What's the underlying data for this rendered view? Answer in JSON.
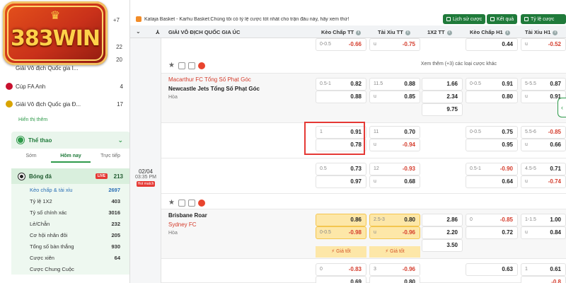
{
  "brand": {
    "logo_text": "383WIN"
  },
  "sidebar": {
    "top_counts": [
      "+7",
      "22",
      "20"
    ],
    "leagues": [
      {
        "label": "Giải Vô địch Quốc gia I...",
        "count": "20"
      },
      {
        "label": "Cúp FA Anh",
        "count": "4"
      },
      {
        "label": "Giải Vô địch Quốc gia Đ...",
        "count": "17"
      }
    ],
    "more_link": "Hiển thị thêm",
    "sport_header": "Thể thao",
    "tabs": [
      "Sớm",
      "Hôm nay",
      "Trực tiếp"
    ],
    "sport": {
      "label": "Bóng đá",
      "live": "LIVE",
      "count": "213"
    },
    "bet_types": [
      {
        "label": "Kèo chấp & tài xỉu",
        "count": "2697"
      },
      {
        "label": "Tỷ lệ 1X2",
        "count": "403"
      },
      {
        "label": "Tỷ số chính xác",
        "count": "3016"
      },
      {
        "label": "Lẻ/Chẵn",
        "count": "232"
      },
      {
        "label": "Cơ hội nhân đôi",
        "count": "205"
      },
      {
        "label": "Tổng số bàn thắng",
        "count": "930"
      },
      {
        "label": "Cược xiên",
        "count": "64"
      },
      {
        "label": "Cược Chung Cuộc",
        "count": ""
      }
    ]
  },
  "topbar": {
    "marquee": "Kataja Basket - Karhu Basket:Chúng tôi có tỷ lệ cược tốt nhất cho trận đấu này, hãy xem thử!",
    "buttons": [
      "Lịch sử cược",
      "Kết quả",
      "Tỷ lệ cược"
    ]
  },
  "columns": {
    "league": "GIẢI VÔ ĐỊCH QUỐC GIA ÚC",
    "headers": [
      "Kèo Chấp TT",
      "Tài Xỉu TT",
      "1X2 TT",
      "Kèo Chấp H1",
      "Tài Xỉu H1"
    ]
  },
  "match0": {
    "row": [
      {
        "h": "0-0.5",
        "v": "-0.66"
      },
      {
        "h": "u",
        "v": "-0.75"
      },
      {
        "h": "",
        "v": ""
      },
      {
        "h": "",
        "v": "0.44"
      },
      {
        "h": "u",
        "v": "-0.52"
      }
    ],
    "more": "Xem thêm (+3) các loại cược khác"
  },
  "match1": {
    "home": "Macarthur FC Tổng Số Phạt Góc",
    "away": "Newcastle Jets Tổng Số Phạt Góc",
    "draw": "Hòa",
    "date": "02/04",
    "time": "03:35 PM",
    "hot": "Hot match",
    "rows": [
      [
        {
          "h": "0.5-1",
          "v": "0.82"
        },
        {
          "h": "11.5",
          "v": "0.88"
        },
        {
          "h": "",
          "v": "1.66"
        },
        {
          "h": "0-0.5",
          "v": "0.91"
        },
        {
          "h": "5-5.5",
          "v": "0.87"
        }
      ],
      [
        {
          "h": "",
          "v": "0.88"
        },
        {
          "h": "u",
          "v": "0.85"
        },
        {
          "h": "",
          "v": "2.34"
        },
        {
          "h": "",
          "v": "0.80"
        },
        {
          "h": "u",
          "v": "0.91"
        }
      ],
      [
        {
          "h": "",
          "v": ""
        },
        {
          "h": "",
          "v": ""
        },
        {
          "h": "",
          "v": "9.75"
        },
        {
          "h": "",
          "v": ""
        },
        {
          "h": "",
          "v": ""
        }
      ],
      [
        {
          "h": "1",
          "v": "0.91"
        },
        {
          "h": "11",
          "v": "0.70"
        },
        {
          "h": "",
          "v": ""
        },
        {
          "h": "0-0.5",
          "v": "0.75"
        },
        {
          "h": "5.5-6",
          "v": "-0.85"
        }
      ],
      [
        {
          "h": "",
          "v": "0.78"
        },
        {
          "h": "u",
          "v": "-0.94"
        },
        {
          "h": "",
          "v": ""
        },
        {
          "h": "",
          "v": "0.95"
        },
        {
          "h": "u",
          "v": "0.66"
        }
      ],
      [
        {
          "h": "0.5",
          "v": "0.73"
        },
        {
          "h": "12",
          "v": "-0.93"
        },
        {
          "h": "",
          "v": ""
        },
        {
          "h": "0.5-1",
          "v": "-0.90"
        },
        {
          "h": "4.5-5",
          "v": "0.71"
        }
      ],
      [
        {
          "h": "",
          "v": "0.97"
        },
        {
          "h": "u",
          "v": "0.68"
        },
        {
          "h": "",
          "v": ""
        },
        {
          "h": "",
          "v": "0.64"
        },
        {
          "h": "u",
          "v": "-0.74"
        }
      ]
    ]
  },
  "match2": {
    "home": "Brisbane Roar",
    "away": "Sydney FC",
    "draw": "Hòa",
    "good_price": "Giá tốt",
    "rows": [
      [
        {
          "h": "",
          "v": "0.86"
        },
        {
          "h": "2.5-3",
          "v": "0.80"
        },
        {
          "h": "",
          "v": "2.86"
        },
        {
          "h": "0",
          "v": "-0.85"
        },
        {
          "h": "1-1.5",
          "v": "1.00"
        }
      ],
      [
        {
          "h": "0-0.5",
          "v": "-0.98"
        },
        {
          "h": "u",
          "v": "-0.96"
        },
        {
          "h": "",
          "v": "2.20"
        },
        {
          "h": "",
          "v": "0.72"
        },
        {
          "h": "u",
          "v": "0.84"
        }
      ],
      [
        {
          "h": "",
          "v": ""
        },
        {
          "h": "",
          "v": ""
        },
        {
          "h": "",
          "v": "3.50"
        },
        {
          "h": "",
          "v": ""
        },
        {
          "h": "",
          "v": ""
        }
      ],
      [
        {
          "h": "0",
          "v": "-0.83"
        },
        {
          "h": "3",
          "v": "-0.96"
        },
        {
          "h": "",
          "v": ""
        },
        {
          "h": "",
          "v": "0.63"
        },
        {
          "h": "1",
          "v": "0.61"
        }
      ],
      [
        {
          "h": "",
          "v": "0.69"
        },
        {
          "h": "",
          "v": "0.80"
        },
        {
          "h": "",
          "v": ""
        },
        {
          "h": "",
          "v": ""
        },
        {
          "h": "",
          "v": "-0.8"
        }
      ]
    ]
  }
}
